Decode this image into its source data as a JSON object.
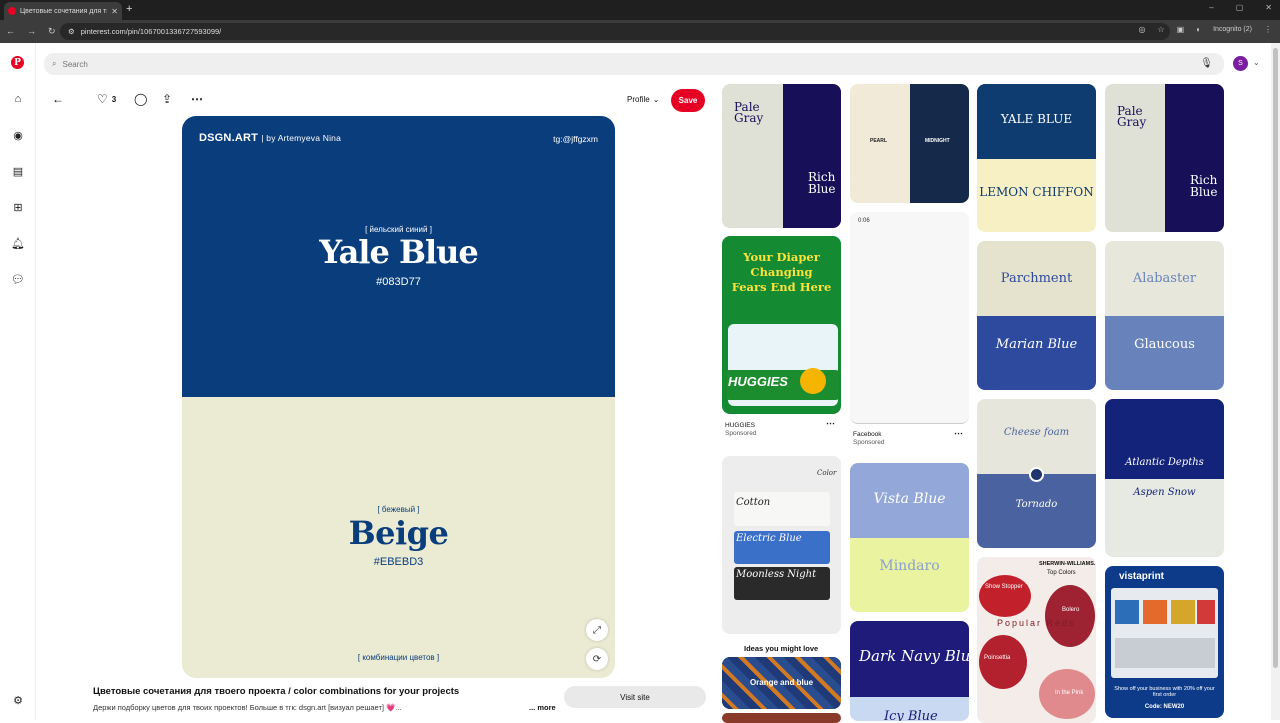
{
  "browser": {
    "tab_title": "Цветовые сочетания для твое...",
    "tab_close": "✕",
    "new_tab": "+",
    "url": "pinterest.com/pin/1067001336727593099/",
    "incognito_label": "Incognito (2)",
    "window_controls": [
      "–",
      "▢",
      "✕"
    ]
  },
  "search": {
    "placeholder": "Search"
  },
  "user": {
    "initial": "S"
  },
  "toolbar": {
    "like_count": "3",
    "profile_label": "Profile",
    "save_label": "Save"
  },
  "pin": {
    "brand": "DSGN.ART",
    "author": "| by Artemyeva Nina",
    "telegram": "tg:@jffgzxm",
    "color1_sub": "[ йельский синий ]",
    "color1_name": "Yale Blue",
    "color1_hex": "#083D77",
    "color2_sub": "[ бежевый ]",
    "color2_name": "Beige",
    "color2_hex": "#EBEBD3",
    "combos_label": "[ комбинации цветов ]",
    "title": "Цветовые сочетания для твоего проекта / color combinations for your projects",
    "description": "Держи подборку цветов для твоих проектов! Больше в тгк: dsgn.art [визуал решает] 💗...",
    "more_label": "... more",
    "visit_label": "Visit site",
    "colors": {
      "yale": "#0a3d7c",
      "beige": "#ebebd3",
      "accent": "#e60023"
    }
  },
  "feed": {
    "col1": {
      "pale_gray_left": "Pale\nGray",
      "rich_blue_right": "Rich\nBlue",
      "ad_headline": "Your Diaper\nChanging\nFears End Here",
      "ad_brand": "HUGGIES",
      "ad_caption": "HUGGIES",
      "ad_sponsored": "Sponsored",
      "swatch_header": "Color",
      "swatch_1": "Cotton",
      "swatch_2": "Electric Blue",
      "swatch_3": "Moonless Night",
      "ideas_label": "Ideas you might love",
      "idea_1": "Orange and blue"
    },
    "col2": {
      "pearl": "PEARL",
      "midnight": "MIDNIGHT",
      "video_time": "0:06",
      "fb_caption": "Facebook",
      "fb_sponsored": "Sponsored",
      "vista_blue": "Vista Blue",
      "mindaro": "Mindaro",
      "dark_navy": "Dark Navy Blue",
      "icy_blue": "Icy Blue"
    },
    "col3": {
      "yale_blue": "YALE BLUE",
      "lemon_chiffon": "LEMON CHIFFON",
      "parchment": "Parchment",
      "marian_blue": "Marian Blue",
      "cheese_foam": "Cheese foam",
      "tornado": "Tornado",
      "sw_brand": "SHERWIN-WILLIAMS.",
      "sw_top": "Top Colors",
      "show_stopper": "Show Stopper",
      "bolero": "Bolero",
      "poinsettia": "Poinsettia",
      "popular_reds": "Popular Reds",
      "in_the_pink": "In the Pink"
    },
    "col4": {
      "pale_gray_left": "Pale\nGray",
      "rich_blue_right": "Rich\nBlue",
      "alabaster": "Alabaster",
      "glaucous": "Glaucous",
      "atlantic": "Atlantic Depths",
      "aspen": "Aspen Snow",
      "vistaprint": "vistaprint",
      "vp_promo": "Show off your business with 20% off your first order",
      "vp_code": "Code: NEW20"
    }
  }
}
